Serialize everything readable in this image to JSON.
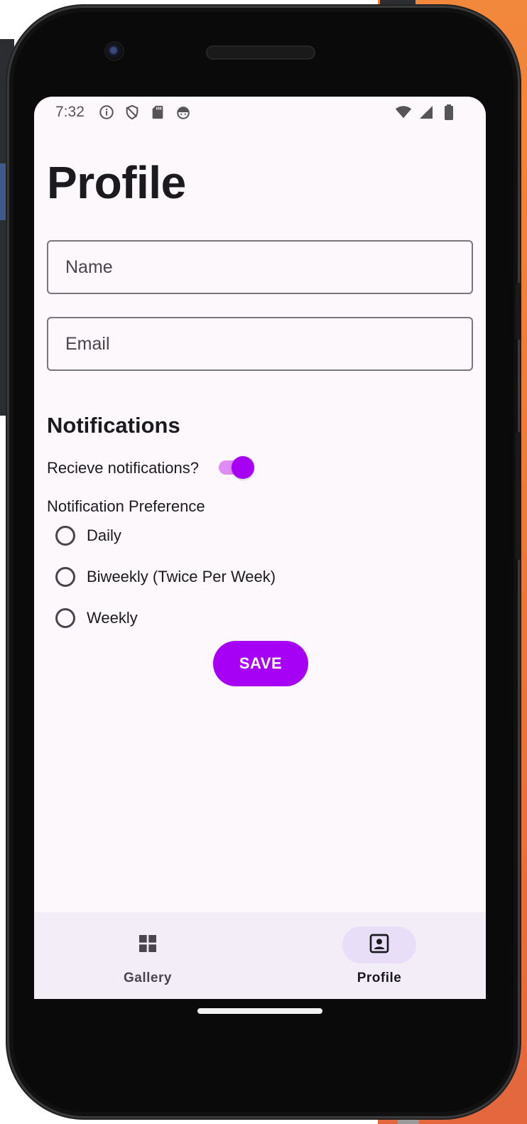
{
  "status_bar": {
    "time": "7:32",
    "left_icons": [
      "info-icon",
      "shield-icon",
      "sd-card-icon",
      "android-debug-icon"
    ],
    "right_icons": [
      "wifi-icon",
      "cell-signal-icon",
      "battery-icon"
    ]
  },
  "page": {
    "title": "Profile"
  },
  "form": {
    "name_placeholder": "Name",
    "name_value": "",
    "email_placeholder": "Email",
    "email_value": ""
  },
  "notifications": {
    "section_title": "Notifications",
    "toggle_label": "Recieve notifications?",
    "toggle_on": true,
    "preference_label": "Notification Preference",
    "options": [
      "Daily",
      "Biweekly (Twice Per Week)",
      "Weekly"
    ],
    "selected_option": null
  },
  "actions": {
    "save_label": "SAVE"
  },
  "bottom_nav": {
    "items": [
      {
        "label": "Gallery",
        "icon": "grid-icon",
        "active": false
      },
      {
        "label": "Profile",
        "icon": "portrait-icon",
        "active": true
      }
    ]
  },
  "colors": {
    "accent": "#a600f5",
    "switch_track": "#df8cf5",
    "screen_bg": "#fdf8fc",
    "nav_bg": "#f3edf7",
    "nav_active_pill": "#e8def8"
  }
}
